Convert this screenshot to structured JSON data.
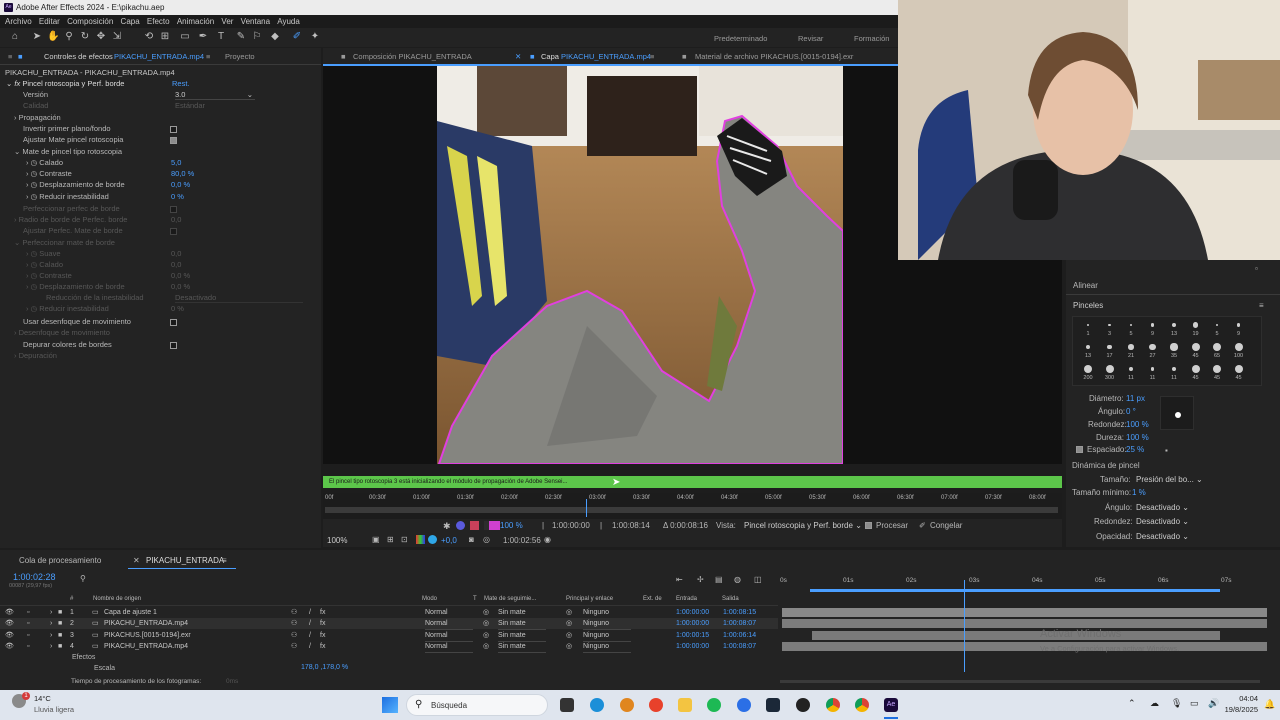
{
  "app": {
    "title": "Adobe After Effects 2024 - E:\\pikachu.aep",
    "logo": "Ae"
  },
  "menu": [
    "Archivo",
    "Editar",
    "Composición",
    "Capa",
    "Efecto",
    "Animación",
    "Ver",
    "Ventana",
    "Ayuda"
  ],
  "workspaces": [
    "Predeterminado",
    "Revisar",
    "Formación"
  ],
  "effects_panel": {
    "tab_label": "Controles de efectos",
    "tab_target": "PIKACHU_ENTRADA.mp4",
    "tab_project": "Proyecto",
    "header": "PIKACHU_ENTRADA - PIKACHU_ENTRADA.mp4",
    "effect_name": "Pincel rotoscopia y Perf. borde",
    "reset": "Rest.",
    "version_label": "Versión",
    "version_value": "3.0",
    "calidad_label": "Calidad",
    "calidad_value": "Estándar",
    "propagacion": "Propagación",
    "invertir": "Invertir primer plano/fondo",
    "ajustar_mate": "Ajustar Mate pincel rotoscopia",
    "mate_group": "Mate de pincel tipo rotoscopia",
    "calado_label": "Calado",
    "calado_value": "5,0",
    "contraste_label": "Contraste",
    "contraste_value": "80,0 %",
    "desp_label": "Desplazamiento de borde",
    "desp_value": "0,0 %",
    "reducir_label": "Reducir inestabilidad",
    "reducir_value": "0 %",
    "perfeccionar": "Perfeccionar perfec de borde",
    "radio": "Radio de borde de Perfec. borde",
    "ajustar_perf": "Ajustar Perfec. Mate de borde",
    "perf_group": "Perfeccionar mate de borde",
    "suave": "Suave",
    "suave_value": "0,0",
    "calado2": "Calado",
    "calado2_value": "0,0",
    "contraste2": "Contraste",
    "contraste2_value": "0,0 %",
    "desp2": "Desplazamiento de borde",
    "desp2_value": "0,0 %",
    "reduccion": "Reducción de la inestabilidad",
    "reduccion_value": "Desactivado",
    "reducir2": "Reducir inestabilidad",
    "reducir2_value": "0 %",
    "usar_desenfoque": "Usar desenfoque de movimiento",
    "desenfoque_mov": "Desenfoque de movimiento",
    "depurar": "Depurar colores de bordes",
    "depuracion": "Depuración"
  },
  "viewer_tabs": {
    "comp_label": "Composición",
    "comp_name": "PIKACHU_ENTRADA",
    "layer_label": "Capa",
    "layer_name": "PIKACHU_ENTRADA.mp4",
    "footage_label": "Material de archivo",
    "footage_name": "PIKACHUS.[0015-0194].exr"
  },
  "progress_text": "El pincel tipo rotoscopia 3 está inicializando el módulo de propagación de Adobe Sensei...",
  "ruler_ticks": [
    "00f",
    "00:30f",
    "01:00f",
    "01:30f",
    "02:00f",
    "02:30f",
    "03:00f",
    "03:30f",
    "04:00f",
    "04:30f",
    "05:00f",
    "05:30f",
    "06:00f",
    "06:30f",
    "07:00f",
    "07:30f",
    "08:00f"
  ],
  "viewer_controls": {
    "zoom": "100 %",
    "time_in": "1:00:00:00",
    "time_out": "1:00:08:14",
    "duration": "Δ 0:00:08:16",
    "vista_label": "Vista:",
    "vista_value": "Pincel rotoscopia y Perf. borde",
    "procesar": "Procesar",
    "congelar": "Congelar",
    "zoom2": "100%",
    "exposure": "+0,0",
    "current": "1:00:02:56"
  },
  "brushes_panel": {
    "alinear": "Alinear",
    "title": "Pinceles",
    "sizes_row1": [
      "1",
      "3",
      "5",
      "9",
      "13",
      "19",
      "5",
      "9"
    ],
    "sizes_row2": [
      "13",
      "17",
      "21",
      "27",
      "35",
      "45",
      "65",
      "100"
    ],
    "sizes_row3": [
      "200",
      "300",
      "11",
      "11",
      "11",
      "45",
      "45",
      "45"
    ],
    "diametro_label": "Diámetro:",
    "diametro_value": "11 px",
    "angulo_label": "Ángulo:",
    "angulo_value": "0 °",
    "redondez_label": "Redondez:",
    "redondez_value": "100 %",
    "dureza_label": "Dureza:",
    "dureza_value": "100 %",
    "espaciado_label": "Espaciado:",
    "espaciado_value": "25 %",
    "dinamica": "Dinámica de pincel",
    "tamano_label": "Tamaño:",
    "tamano_value": "Presión del bo...",
    "tamano_min_label": "Tamaño mínimo:",
    "tamano_min_value": "1 %",
    "angulo2_label": "Ángulo:",
    "angulo2_value": "Desactivado",
    "redondez2_label": "Redondez:",
    "redondez2_value": "Desactivado",
    "opacidad_label": "Opacidad:",
    "opacidad_value": "Desactivado"
  },
  "timeline": {
    "queue_tab": "Cola de procesamiento",
    "comp_tab": "PIKACHU_ENTRADA",
    "current_time": "1:00:02:28",
    "frames": "00087 (29,97 fps)",
    "headers": {
      "num": "#",
      "name": "Nombre de origen",
      "mode": "Modo",
      "t": "T",
      "track": "Mate de seguimie...",
      "parent": "Principal y enlace",
      "stretch": "Ext. de",
      "in": "Entrada",
      "out": "Salida"
    },
    "layers": [
      {
        "num": "1",
        "name": "Capa de ajuste 1",
        "mode": "Normal",
        "track": "Sin mate",
        "parent": "Ninguno",
        "in": "1:00:00:00",
        "out": "1:00:08:15"
      },
      {
        "num": "2",
        "name": "PIKACHU_ENTRADA.mp4",
        "mode": "Normal",
        "track": "Sin mate",
        "parent": "Ninguno",
        "in": "1:00:00:00",
        "out": "1:00:08:07"
      },
      {
        "num": "3",
        "name": "PIKACHUS.[0015-0194].exr",
        "mode": "Normal",
        "track": "Sin mate",
        "parent": "Ninguno",
        "in": "1:00:00:15",
        "out": "1:00:06:14"
      },
      {
        "num": "4",
        "name": "PIKACHU_ENTRADA.mp4",
        "mode": "Normal",
        "track": "Sin mate",
        "parent": "Ninguno",
        "in": "1:00:00:00",
        "out": "1:00:08:07"
      }
    ],
    "efectos": "Efectos",
    "escala": "Escala",
    "escala_value": "178,0 ,178,0 %",
    "ticks": [
      "0s",
      "01s",
      "02s",
      "03s",
      "04s",
      "05s",
      "06s",
      "07s"
    ],
    "render_time": "Tiempo de procesamiento de los fotogramas:",
    "render_value": "0ms",
    "watermark1": "Activar Windows",
    "watermark2": "Ve a Configuración para activar Windows."
  },
  "taskbar": {
    "temp": "14°C",
    "weather": "Lluvia ligera",
    "search": "Búsqueda",
    "time": "04:04",
    "date": "19/8/2025",
    "badge": "1"
  },
  "colors": {
    "accent": "#4a9eff",
    "progress": "#5cc64a",
    "roto_outline": "#e040e0"
  }
}
